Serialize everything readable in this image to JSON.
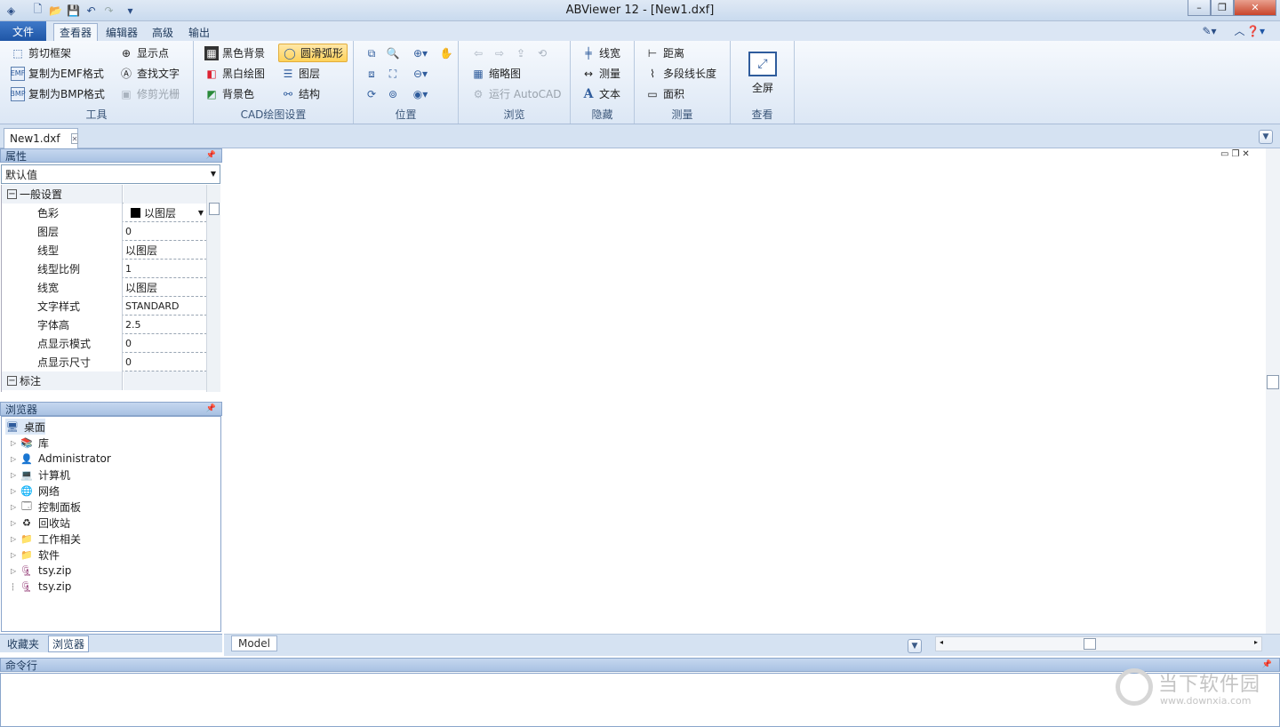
{
  "window": {
    "title": "ABViewer 12 - [New1.dxf]",
    "controls": [
      "minimize",
      "restore",
      "close"
    ]
  },
  "ribbon_tabs": [
    {
      "label": "文件"
    },
    {
      "label": "查看器"
    },
    {
      "label": "编辑器"
    },
    {
      "label": "高级"
    },
    {
      "label": "输出"
    }
  ],
  "groups": {
    "tools": {
      "label": "工具",
      "items": [
        "剪切框架",
        "复制为EMF格式",
        "复制为BMP格式",
        "显示点",
        "查找文字",
        "修剪光栅"
      ]
    },
    "cad": {
      "label": "CAD绘图设置",
      "items": [
        "黑色背景",
        "黑白绘图",
        "背景色",
        "圆滑弧形",
        "图层",
        "结构"
      ]
    },
    "position": {
      "label": "位置"
    },
    "browse": {
      "label": "浏览",
      "items": [
        "缩略图",
        "运行 AutoCAD"
      ]
    },
    "hide": {
      "label": "隐藏",
      "items": [
        "线宽",
        "测量",
        "文本"
      ]
    },
    "measure": {
      "label": "测量",
      "items": [
        "距离",
        "多段线长度",
        "面积"
      ]
    },
    "view": {
      "label": "查看",
      "items": [
        "全屏"
      ]
    }
  },
  "document_tab": "New1.dxf",
  "properties": {
    "title": "属性",
    "selector": "默认值",
    "category_general": "一般设置",
    "rows": [
      {
        "key": "色彩",
        "value": "以图层"
      },
      {
        "key": "图层",
        "value": "0"
      },
      {
        "key": "线型",
        "value": "以图层"
      },
      {
        "key": "线型比例",
        "value": "1"
      },
      {
        "key": "线宽",
        "value": "以图层"
      },
      {
        "key": "文字样式",
        "value": "STANDARD"
      },
      {
        "key": "字体高",
        "value": "2.5"
      },
      {
        "key": "点显示模式",
        "value": "0"
      },
      {
        "key": "点显示尺寸",
        "value": "0"
      }
    ],
    "category_dim": "标注"
  },
  "browser": {
    "title": "浏览器",
    "root": "桌面",
    "items": [
      {
        "label": "库",
        "icon": "library-icon"
      },
      {
        "label": "Administrator",
        "icon": "user-folder-icon"
      },
      {
        "label": "计算机",
        "icon": "computer-icon"
      },
      {
        "label": "网络",
        "icon": "network-icon"
      },
      {
        "label": "控制面板",
        "icon": "control-panel-icon"
      },
      {
        "label": "回收站",
        "icon": "recycle-bin-icon"
      },
      {
        "label": "工作相关",
        "icon": "folder-icon"
      },
      {
        "label": "软件",
        "icon": "folder-icon"
      },
      {
        "label": "tsy.zip",
        "icon": "archive-icon"
      },
      {
        "label": "tsy.zip",
        "icon": "archive-icon"
      }
    ]
  },
  "bottom_tabs": [
    {
      "label": "收藏夹"
    },
    {
      "label": "浏览器"
    }
  ],
  "model_tab": "Model",
  "command_line": {
    "title": "命令行"
  },
  "watermark": {
    "brand": "当下软件园",
    "url": "www.downxia.com"
  }
}
